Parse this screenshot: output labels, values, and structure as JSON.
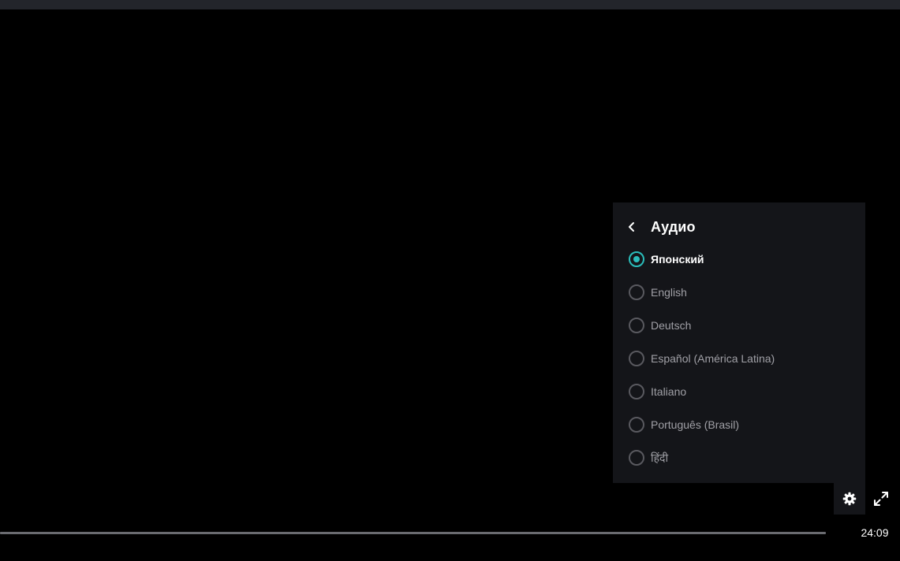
{
  "audio_menu": {
    "title": "Аудио",
    "back_icon": "chevron-left-icon",
    "options": [
      {
        "label": "Японский",
        "selected": true
      },
      {
        "label": "English",
        "selected": false
      },
      {
        "label": "Deutsch",
        "selected": false
      },
      {
        "label": "Español (América Latina)",
        "selected": false
      },
      {
        "label": "Italiano",
        "selected": false
      },
      {
        "label": "Português (Brasil)",
        "selected": false
      },
      {
        "label": "हिंदी",
        "selected": false
      }
    ]
  },
  "controls": {
    "settings_icon": "gear-icon",
    "fullscreen_icon": "expand-icon",
    "duration": "24:09",
    "progress": 0
  },
  "colors": {
    "accent": "#2abdbb",
    "menu_background": "#141519",
    "top_strip": "#23252b",
    "track": "#6a6b70"
  }
}
